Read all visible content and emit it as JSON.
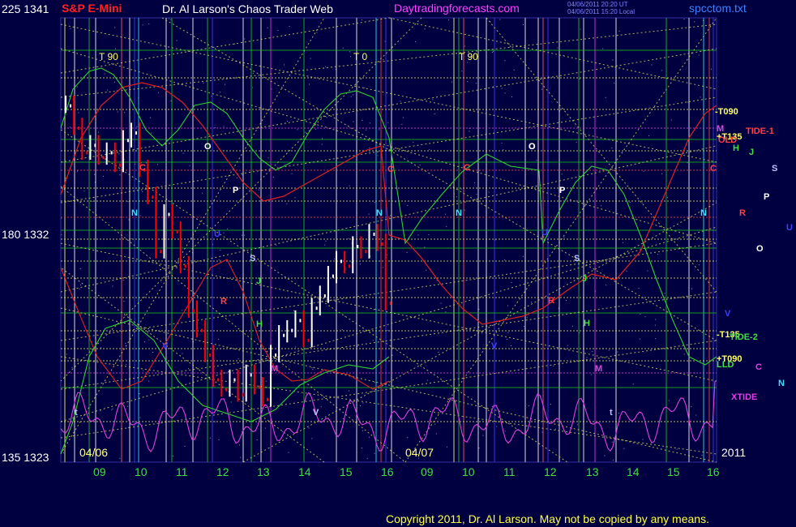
{
  "header": {
    "symbol_label": "S&P E-Mini",
    "title": "Dr. Al Larson's Chaos Trader Web",
    "site": "Daytradingforecasts.com",
    "stamp_line1": "04/06/2011 20:20 UT",
    "stamp_line2": "04/06/2011 15:20 Local",
    "filename": "spcctom.txt"
  },
  "footer": {
    "copyright": "Copyright 2011, Dr. Al Larson. May not be copied by any means."
  },
  "colors": {
    "background": "#000040",
    "price_up": "#ffffff",
    "price_down": "#ff0000",
    "grid_yellow": "#e8e860",
    "grid_green": "#20c020",
    "tide_red": "#e02020",
    "tide_green": "#30d030",
    "xtide_magenta": "#e040e0"
  },
  "chart_data": {
    "type": "line",
    "x_label_type": "hour-of-day",
    "hours": [
      "09",
      "10",
      "11",
      "12",
      "13",
      "14",
      "15",
      "16",
      "09",
      "10",
      "11",
      "12",
      "13",
      "14",
      "15",
      "16"
    ],
    "dates": [
      "04/06",
      "04/07"
    ],
    "year": "2011",
    "y_axis_labels": [
      {
        "angle": "225",
        "price": "1341"
      },
      {
        "angle": "180",
        "price": "1332"
      },
      {
        "angle": "135",
        "price": "1323"
      }
    ],
    "ylim": [
      1323,
      1341
    ],
    "time_markers": [
      {
        "label": "T",
        "value": "90"
      },
      {
        "label": "T",
        "value": "0"
      },
      {
        "label": "T",
        "value": "90"
      }
    ],
    "right_labels": [
      "-T090",
      "M",
      "+T135",
      "TIDE-1",
      "OLD",
      "H",
      "J",
      "C",
      "S",
      "P",
      "R",
      "U",
      "O",
      "N",
      "V",
      "-T135",
      "TIDE-2",
      "+T090",
      "LLD",
      "C",
      "N",
      "XTIDE"
    ],
    "planet_markers": [
      "C",
      "O",
      "P",
      "U",
      "N",
      "S",
      "J",
      "R",
      "H",
      "V",
      "M",
      "t",
      "C",
      "N",
      "O",
      "V",
      "C",
      "N",
      "O",
      "P",
      "U",
      "R",
      "S",
      "J",
      "H",
      "M",
      "t",
      "V"
    ],
    "price_series": {
      "name": "S&P E-Mini",
      "day1_x": [
        8.1,
        8.3,
        8.5,
        8.7,
        8.9,
        9.1,
        9.3,
        9.5,
        9.7,
        9.9,
        10.1,
        10.3,
        10.5,
        10.7,
        10.9,
        11.1,
        11.3,
        11.5,
        11.7,
        11.9,
        12.1,
        12.3,
        12.5,
        12.7,
        12.9,
        13.1,
        13.3,
        13.5,
        13.7,
        13.9,
        14.1,
        14.3,
        14.5,
        14.7,
        14.9,
        15.1,
        15.3,
        15.5,
        15.7,
        15.9
      ],
      "day1_close": [
        1337.5,
        1336.6,
        1335.6,
        1335.9,
        1335.4,
        1335.6,
        1335.1,
        1336.1,
        1336.4,
        1334.9,
        1333.8,
        1331.6,
        1333.1,
        1332.4,
        1331.0,
        1329.2,
        1328.4,
        1327.4,
        1326.4,
        1326.0,
        1326.4,
        1325.8,
        1326.6,
        1326.1,
        1325.6,
        1327.4,
        1328.2,
        1328.4,
        1328.8,
        1328.0,
        1329.3,
        1329.8,
        1330.6,
        1331.2,
        1331.0,
        1331.8,
        1331.6,
        1332.3,
        1331.9,
        1329.5
      ]
    },
    "tide_curves": [
      {
        "name": "TIDE-1",
        "color": "red"
      },
      {
        "name": "TIDE-2",
        "color": "green"
      },
      {
        "name": "XTIDE",
        "color": "magenta"
      }
    ]
  }
}
